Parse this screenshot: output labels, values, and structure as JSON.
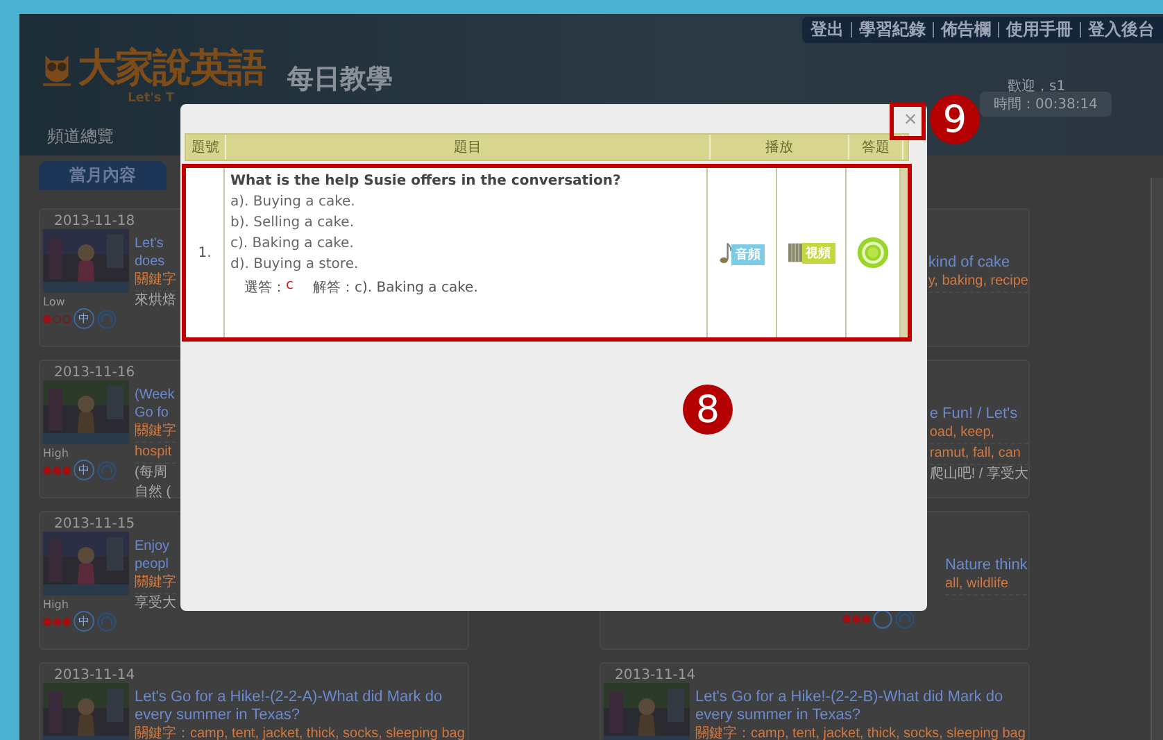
{
  "top_links": [
    "登出",
    "學習紀錄",
    "佈告欄",
    "使用手冊",
    "登入後台"
  ],
  "logo": {
    "title": "大家說英語",
    "subtitle": "Let's T"
  },
  "section_title": "每日教學",
  "welcome": "歡迎，s1",
  "timer": "時間：00:38:14",
  "nav": [
    {
      "label": "頻道總覽",
      "selected": false
    }
  ],
  "month_tab": "當月內容",
  "cards_left": [
    {
      "date": "2013-11-18",
      "title": [
        "Let's",
        "does"
      ],
      "keywords": [
        "關鍵字"
      ],
      "note": [
        "來烘焙"
      ],
      "level_label": "Low",
      "stars": 1,
      "lang": "中"
    },
    {
      "date": "2013-11-16",
      "title": [
        "(Week",
        "Go fo"
      ],
      "keywords": [
        "關鍵字",
        "hospit"
      ],
      "note": [
        "(每周",
        "自然 ("
      ],
      "level_label": "High",
      "stars": 3,
      "lang": "中"
    },
    {
      "date": "2013-11-15",
      "title": [
        "Enjoy",
        "peopl"
      ],
      "keywords": [
        "關鍵字"
      ],
      "note": [
        "享受大"
      ],
      "level_label": "High",
      "stars": 3,
      "lang": "中"
    },
    {
      "date": "2013-11-14",
      "title": [
        "Let's Go for a Hike!-(2-2-A)-What did Mark do",
        "every summer in Texas?"
      ],
      "keywords": [
        "關鍵字：camp, tent, jacket, thick, socks, sleeping bag"
      ]
    }
  ],
  "cards_right": [
    {
      "title": [
        "kind of cake"
      ],
      "keywords": [
        "y, baking, recipe"
      ]
    },
    {
      "title": [
        "e Fun! / Let's"
      ],
      "keywords": [
        "oad, keep,",
        "ramut, fall, can"
      ],
      "note": [
        "爬山吧! / 享受大"
      ]
    },
    {
      "title": [
        "Nature think"
      ],
      "keywords": [
        "all, wildlife"
      ],
      "stars": 3
    },
    {
      "date": "2013-11-14",
      "title": [
        "Let's Go for a Hike!-(2-2-B)-What did Mark do",
        "every summer in Texas?"
      ],
      "keywords": [
        "關鍵字：camp, tent, jacket, thick, socks, sleeping bag"
      ]
    }
  ],
  "dialog": {
    "close": "×",
    "columns": [
      "題號",
      "題目",
      "播放",
      "答題"
    ],
    "rows": [
      {
        "number": "1.",
        "question": "What is the help Susie offers in the conversation?",
        "options": [
          "a). Buying a cake.",
          "b). Selling a cake.",
          "c). Baking a cake.",
          "d). Buying a store."
        ],
        "choice_label": "選答：",
        "choice": "c",
        "answer_label": "解答：",
        "answer": "c). Baking a cake.",
        "audio": "音頻",
        "video": "視頻",
        "highlighted": true
      }
    ]
  },
  "callouts": [
    {
      "number": "9"
    },
    {
      "number": "8"
    }
  ]
}
